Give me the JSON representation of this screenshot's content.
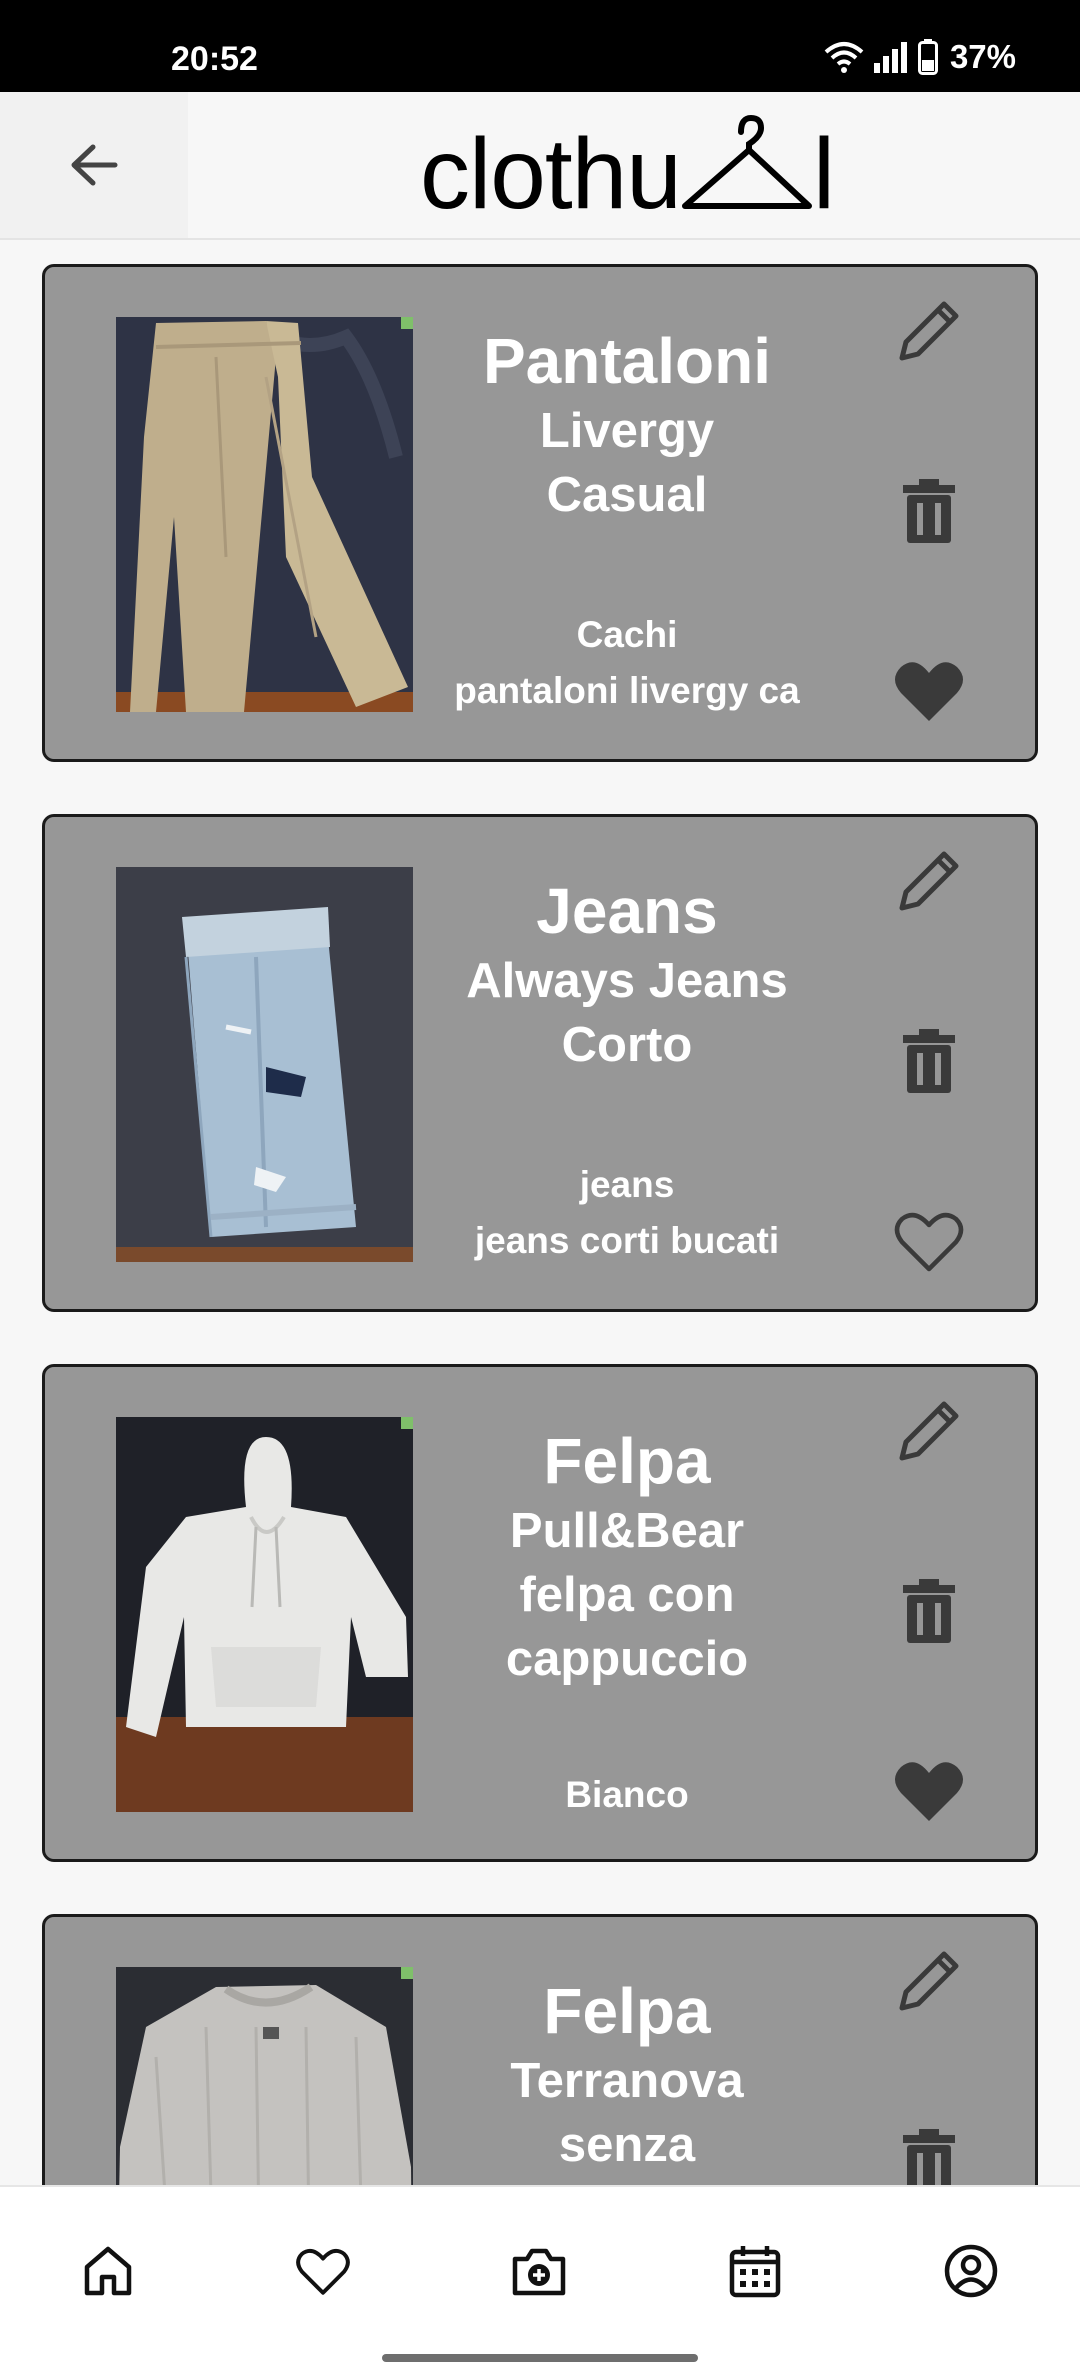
{
  "status_bar": {
    "time": "20:52",
    "battery_text": "37%"
  },
  "header": {
    "logo_text": "clothu",
    "logo_end": "l"
  },
  "items": [
    {
      "category": "Pantaloni",
      "brand": "Livergy",
      "style": "Casual",
      "color": "Cachi",
      "description": "pantaloni livergy ca",
      "favorite": true,
      "photo": "khaki-trousers"
    },
    {
      "category": "Jeans",
      "brand": "Always Jeans",
      "style": "Corto",
      "color": "jeans",
      "description": "jeans corti bucati",
      "favorite": false,
      "photo": "ripped-denim-shorts"
    },
    {
      "category": "Felpa",
      "brand": "Pull&Bear",
      "style": "felpa con cappuccio",
      "color": "Bianco",
      "description": "",
      "favorite": true,
      "photo": "white-hoodie"
    },
    {
      "category": "Felpa",
      "brand": "Terranova",
      "style": "senza",
      "color": "",
      "description": "",
      "favorite": false,
      "photo": "grey-sweater"
    }
  ],
  "icons": {
    "back": "arrow-back-icon",
    "edit": "pencil-icon",
    "delete": "trash-icon",
    "favorite_on": "heart-filled-icon",
    "favorite_off": "heart-outline-icon",
    "nav": [
      "home-icon",
      "heart-icon",
      "add-photo-icon",
      "calendar-icon",
      "profile-icon"
    ]
  },
  "colors": {
    "card_background": "#979797",
    "card_border": "#1a1a1a",
    "icon_dark": "#3a3a3a",
    "status_bar": "#000000"
  }
}
